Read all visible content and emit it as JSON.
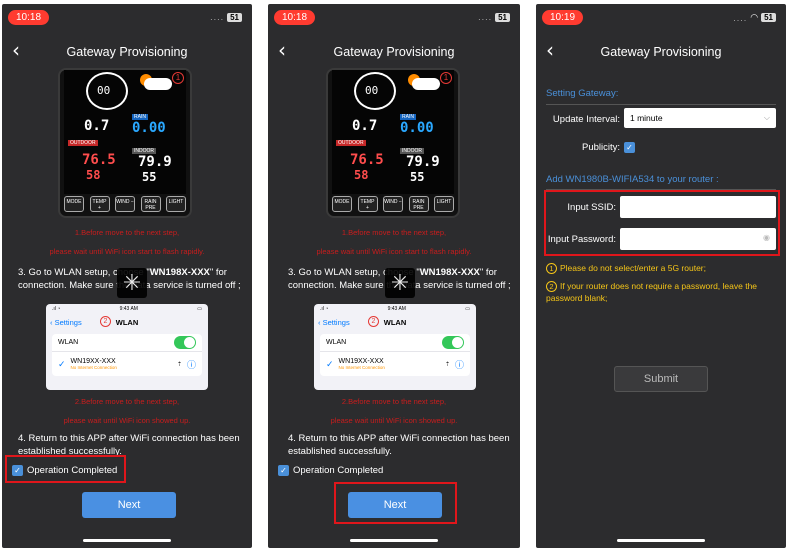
{
  "screens": [
    {
      "time": "10:18",
      "battery": "51",
      "title": "Gateway Provisioning",
      "device": {
        "wind": "00",
        "rain": "0.00",
        "wind_speed": "0.7",
        "outdoor_temp": "76.5",
        "outdoor_hum": "58",
        "indoor_temp": "79.9",
        "indoor_hum": "55",
        "keys": [
          "MODE",
          "TEMP +",
          "WIND −",
          "RAIN PRE",
          "LIGHT"
        ]
      },
      "warn1a": "1.Before move to the next step,",
      "warn1b": "please wait until WiFi icon start to flash rapidly.",
      "step3_pre": "3. Go to WLAN setup, choose \"",
      "step3_ssid": "WN198X-XXX",
      "step3_post": "\" for connection. Make sure the data service is turned off ;",
      "ios": {
        "time": "9:43 AM",
        "back": "Settings",
        "title": "WLAN",
        "marker": "2",
        "wlan": "WLAN",
        "network": "WN19XX-XXX",
        "no_internet": "No Internet Connection"
      },
      "warn2a": "2.Before move to the next step,",
      "warn2b": "please wait until WiFi icon showed up.",
      "step4": "4. Return to this APP after WiFi connection has been established successfully.",
      "op_completed": "Operation Completed",
      "next": "Next"
    },
    {
      "time": "10:19",
      "battery": "51",
      "title": "Gateway Provisioning",
      "setting_gateway": "Setting Gateway:",
      "update_interval_label": "Update Interval:",
      "update_interval_value": "1 minute",
      "publicity_label": "Publicity:",
      "add_router": "Add WN1980B-WIFIA534 to your router :",
      "ssid_label": "Input SSID:",
      "password_label": "Input Password:",
      "note1_num": "1",
      "note1": "Please do not select/enter a 5G router;",
      "note2_num": "2",
      "note2": "If your router does not require a password, leave the password blank;",
      "submit": "Submit"
    }
  ]
}
